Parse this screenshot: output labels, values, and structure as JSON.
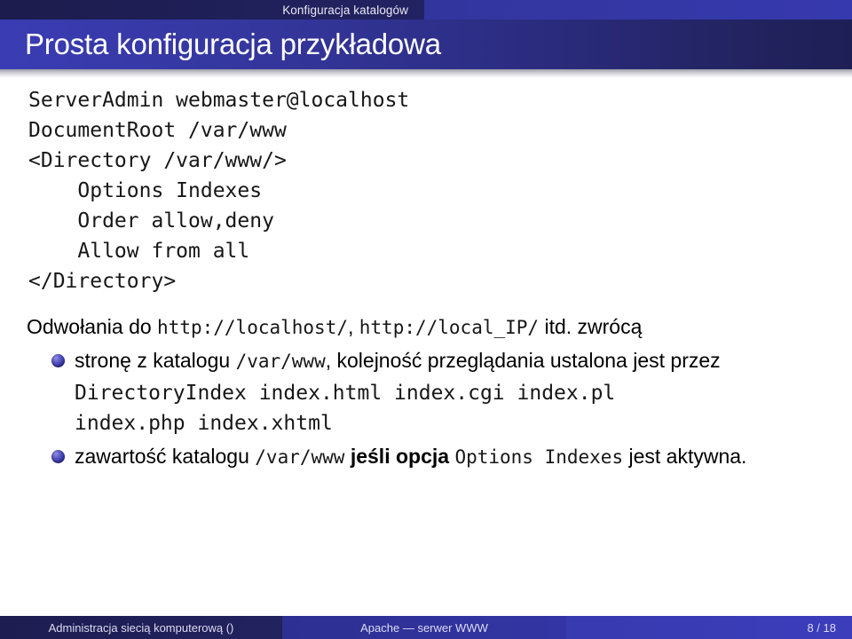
{
  "header": {
    "section": "Konfiguracja katalogów",
    "title": "Prosta konfiguracja przykładowa"
  },
  "content": {
    "code_block": "ServerAdmin webmaster@localhost\nDocumentRoot /var/www\n<Directory /var/www/>\n    Options Indexes\n    Order allow,deny\n    Allow from all\n</Directory>",
    "paragraph": {
      "lead": "Odwołania do ",
      "url1": "http://localhost/",
      "sep": ", ",
      "url2": "http://local_IP/",
      "tail": " itd. zwrócą"
    },
    "bullets": [
      {
        "part1": "stronę z katalogu ",
        "mono1": "/var/www",
        "part2": ", kolejność przeglądania ustalona jest przez",
        "code_lines": "DirectoryIndex index.html index.cgi index.pl\nindex.php index.xhtml"
      },
      {
        "part1": "zawartość katalogu ",
        "mono1": "/var/www",
        "part2": " jeśli opcja ",
        "mono2": "Options Indexes",
        "part3": " jest aktywna."
      }
    ]
  },
  "footer": {
    "left": "Administracja siecią komputerową  ()",
    "center": "Apache — serwer WWW",
    "page": "8 / 18"
  },
  "colors": {
    "header_dark": "#1e1f55",
    "header_blue": "#3a3cb4",
    "accent_bullet": "#2f2f9a",
    "text": "#000000"
  }
}
